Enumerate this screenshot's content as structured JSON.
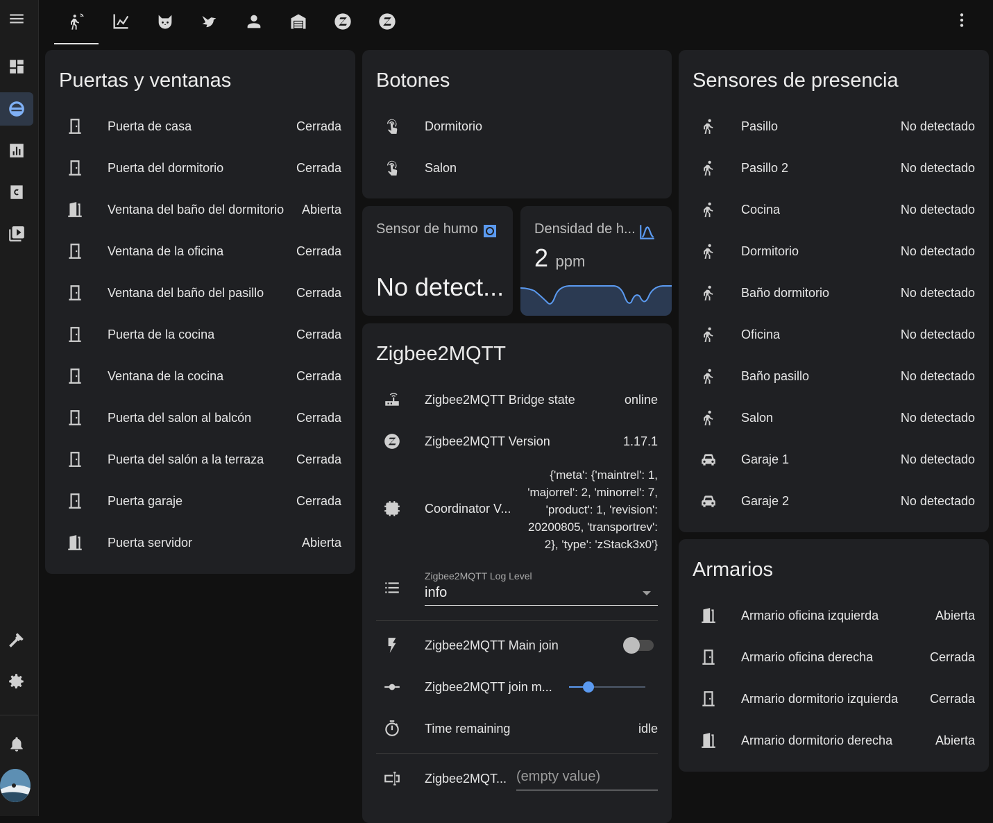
{
  "colors": {
    "accent": "#5b9af0",
    "background": "#111111",
    "card": "#1f2023",
    "sidebar_active": "#2e3847"
  },
  "sidebar": {
    "items": [
      {
        "icon": "menu-icon"
      },
      {
        "icon": "dashboard-icon"
      },
      {
        "icon": "map-icon"
      },
      {
        "icon": "chart-bar-icon"
      },
      {
        "icon": "code-icon"
      },
      {
        "icon": "media-icon"
      },
      {
        "icon": "hammer-icon"
      },
      {
        "icon": "gear-icon"
      },
      {
        "icon": "bell-icon"
      }
    ]
  },
  "tabs": [
    {
      "icon": "motion-sensor-icon",
      "active": true
    },
    {
      "icon": "chart-line-icon"
    },
    {
      "icon": "cat-icon"
    },
    {
      "icon": "bird-icon"
    },
    {
      "icon": "account-icon"
    },
    {
      "icon": "garage-icon"
    },
    {
      "icon": "zigbee-icon"
    },
    {
      "icon": "zigbee-icon"
    }
  ],
  "puertas": {
    "title": "Puertas y ventanas",
    "rows": [
      {
        "name": "Puerta de casa",
        "value": "Cerrada",
        "icon": "door-closed-icon"
      },
      {
        "name": "Puerta del dormitorio",
        "value": "Cerrada",
        "icon": "door-closed-icon"
      },
      {
        "name": "Ventana del baño del dormitorio",
        "value": "Abierta",
        "icon": "door-open-icon"
      },
      {
        "name": "Ventana de la oficina",
        "value": "Cerrada",
        "icon": "door-closed-icon"
      },
      {
        "name": "Ventana del baño del pasillo",
        "value": "Cerrada",
        "icon": "door-closed-icon"
      },
      {
        "name": "Puerta de la cocina",
        "value": "Cerrada",
        "icon": "door-closed-icon"
      },
      {
        "name": "Ventana de la cocina",
        "value": "Cerrada",
        "icon": "door-closed-icon"
      },
      {
        "name": "Puerta del salon al balcón",
        "value": "Cerrada",
        "icon": "door-closed-icon"
      },
      {
        "name": "Puerta del salón a la terraza",
        "value": "Cerrada",
        "icon": "door-closed-icon"
      },
      {
        "name": "Puerta garaje",
        "value": "Cerrada",
        "icon": "door-closed-icon"
      },
      {
        "name": "Puerta servidor",
        "value": "Abierta",
        "icon": "door-open-icon"
      }
    ]
  },
  "botones": {
    "title": "Botones",
    "rows": [
      {
        "name": "Dormitorio",
        "icon": "gesture-tap-icon"
      },
      {
        "name": "Salon",
        "icon": "gesture-tap-icon"
      }
    ]
  },
  "humo": {
    "name": "Sensor de humo",
    "value": "No detect...",
    "icon": "smoke-detector-icon"
  },
  "densidad": {
    "name": "Densidad de h...",
    "value": "2",
    "unit": "ppm",
    "icon": "chart-bell-curve-icon"
  },
  "zigbee": {
    "title": "Zigbee2MQTT",
    "bridge": {
      "name": "Zigbee2MQTT Bridge state",
      "value": "online",
      "icon": "router-icon"
    },
    "version": {
      "name": "Zigbee2MQTT Version",
      "value": "1.17.1",
      "icon": "zigbee-icon"
    },
    "coordinator": {
      "name": "Coordinator V...",
      "value": "{'meta': {'maintrel': 1, 'majorrel': 2, 'minorrel': 7, 'product': 1, 'revision': 20200805, 'transportrev': 2}, 'type': 'zStack3x0'}",
      "icon": "chip-icon"
    },
    "log_level": {
      "label": "Zigbee2MQTT Log Level",
      "value": "info",
      "icon": "list-icon"
    },
    "main_join": {
      "name": "Zigbee2MQTT Main join",
      "state": "off",
      "icon": "flash-icon"
    },
    "join_minutes": {
      "name": "Zigbee2MQTT join m...",
      "level": 0.25,
      "icon": "slider-icon"
    },
    "time_remaining": {
      "name": "Time remaining",
      "value": "idle",
      "icon": "timer-icon"
    },
    "text": {
      "name": "Zigbee2MQT...",
      "placeholder": "(empty value)",
      "icon": "form-textbox-icon"
    }
  },
  "presencia": {
    "title": "Sensores de presencia",
    "rows": [
      {
        "name": "Pasillo",
        "value": "No detectado",
        "icon": "walk-icon"
      },
      {
        "name": "Pasillo 2",
        "value": "No detectado",
        "icon": "walk-icon"
      },
      {
        "name": "Cocina",
        "value": "No detectado",
        "icon": "walk-icon"
      },
      {
        "name": "Dormitorio",
        "value": "No detectado",
        "icon": "walk-icon"
      },
      {
        "name": "Baño dormitorio",
        "value": "No detectado",
        "icon": "walk-icon"
      },
      {
        "name": "Oficina",
        "value": "No detectado",
        "icon": "walk-icon"
      },
      {
        "name": "Baño pasillo",
        "value": "No detectado",
        "icon": "walk-icon"
      },
      {
        "name": "Salon",
        "value": "No detectado",
        "icon": "walk-icon"
      },
      {
        "name": "Garaje 1",
        "value": "No detectado",
        "icon": "car-icon"
      },
      {
        "name": "Garaje 2",
        "value": "No detectado",
        "icon": "car-icon"
      }
    ]
  },
  "armarios": {
    "title": "Armarios",
    "rows": [
      {
        "name": "Armario oficina izquierda",
        "value": "Abierta",
        "icon": "door-open-icon"
      },
      {
        "name": "Armario oficina derecha",
        "value": "Cerrada",
        "icon": "door-closed-icon"
      },
      {
        "name": "Armario dormitorio izquierda",
        "value": "Cerrada",
        "icon": "door-closed-icon"
      },
      {
        "name": "Armario dormitorio derecha",
        "value": "Abierta",
        "icon": "door-open-icon"
      }
    ]
  }
}
